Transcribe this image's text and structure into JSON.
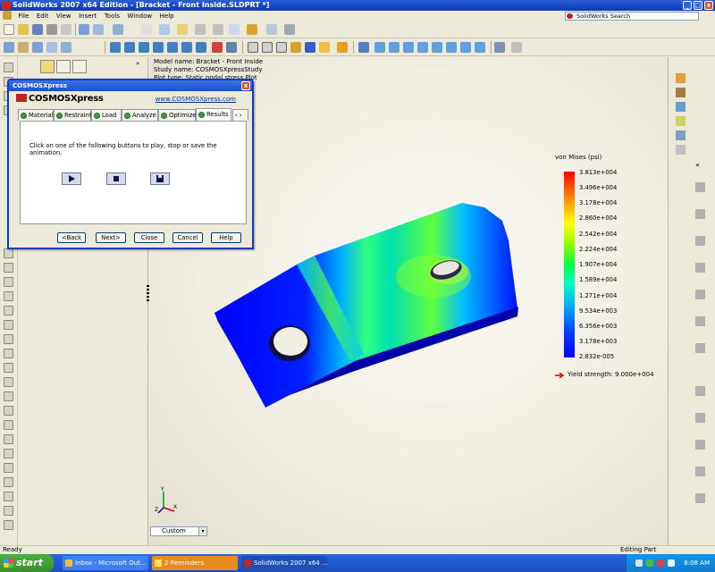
{
  "window": {
    "title": "SolidWorks 2007 x64 Edition - [Bracket - Front Inside.SLDPRT *]",
    "minimize": "_",
    "maximize": "□",
    "close": "x"
  },
  "menu": {
    "items": [
      "File",
      "Edit",
      "View",
      "Insert",
      "Tools",
      "Window",
      "Help"
    ],
    "search_label": "SolidWorks Search"
  },
  "study": {
    "model_name": "Model name: Bracket - Front Inside",
    "study_name": "Study name: COSMOSXpressStudy",
    "plot_type": "Plot type: Static nodal stress Plot"
  },
  "legend": {
    "title": "von Mises (psi)",
    "values": [
      "3.813e+004",
      "3.496e+004",
      "3.178e+004",
      "2.860e+004",
      "2.542e+004",
      "2.224e+004",
      "1.907e+004",
      "1.589e+004",
      "1.271e+004",
      "9.534e+003",
      "6.356e+003",
      "3.178e+003",
      "2.832e-005"
    ],
    "yield_strength": "Yield strength: 9.000e+004",
    "colors": {
      "max": "#ff0000",
      "min": "#0000ff"
    }
  },
  "view": {
    "orientation": "Custom",
    "triad_axes": [
      "Y",
      "X",
      "Z"
    ]
  },
  "dialog": {
    "title": "COSMOSXpress",
    "close": "x",
    "logo": "COSMOSXpress",
    "url": "www.COSMOSXpress.com",
    "tabs": [
      "Material",
      "Restraint",
      "Load",
      "Analyze",
      "Optimize",
      "Results"
    ],
    "active_tab": "Results",
    "tab_scroll": "‹ ›",
    "instruction": "Click on one of the following buttons to play, stop or save the animation.",
    "buttons": {
      "back": "<Back",
      "next": "Next>",
      "close": "Close",
      "cancel": "Cancel",
      "help": "Help"
    }
  },
  "status": {
    "left": "Ready",
    "right": "Editing Part"
  },
  "taskbar": {
    "start": "start",
    "tasks": [
      "Inbox - Microsoft Out...",
      "2 Reminders",
      "SolidWorks 2007 x64 ..."
    ],
    "clock": "8:08 AM"
  }
}
